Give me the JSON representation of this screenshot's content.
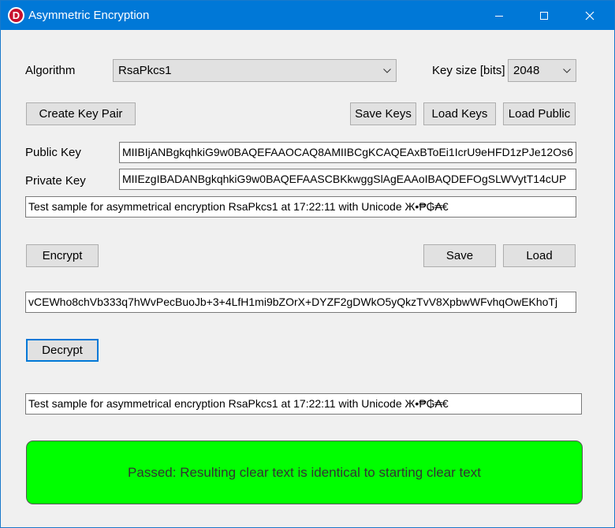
{
  "window": {
    "title": "Asymmetric Encryption",
    "app_icon_letter": "D"
  },
  "algorithm": {
    "label": "Algorithm",
    "selected": "RsaPkcs1"
  },
  "key_size": {
    "label": "Key size [bits]",
    "selected": "2048"
  },
  "buttons": {
    "create_key_pair": "Create Key Pair",
    "save_keys": "Save Keys",
    "load_keys": "Load Keys",
    "load_public": "Load Public",
    "encrypt": "Encrypt",
    "save": "Save",
    "load": "Load",
    "decrypt": "Decrypt"
  },
  "public_key": {
    "label": "Public Key",
    "value": "MIIBIjANBgkqhkiG9w0BAQEFAAOCAQ8AMIIBCgKCAQEAxBToEi1IcrU9eHFD1zPJe12Os6"
  },
  "private_key": {
    "label": "Private Key",
    "value": "MIIEzgIBADANBgkqhkiG9w0BAQEFAASCBKkwggSlAgEAAoIBAQDEFOgSLWVytT14cUP"
  },
  "clear_text": "Test sample for asymmetrical encryption RsaPkcs1 at 17:22:11 with Unicode Ж•₱₲₳€",
  "cipher_text": "vCEWho8chVb333q7hWvPecBuoJb+3+4LfH1mi9bZOrX+DYZF2gDWkO5yQkzTvV8XpbwWFvhqOwEKhoTj",
  "decrypted_text": "Test sample for asymmetrical encryption RsaPkcs1 at 17:22:11 with Unicode Ж•₱₲₳€",
  "result_message": "Passed: Resulting clear text is identical to starting clear text",
  "colors": {
    "titlebar": "#0078d7",
    "result_background": "#00ff00",
    "focus_border": "#0078d7"
  }
}
